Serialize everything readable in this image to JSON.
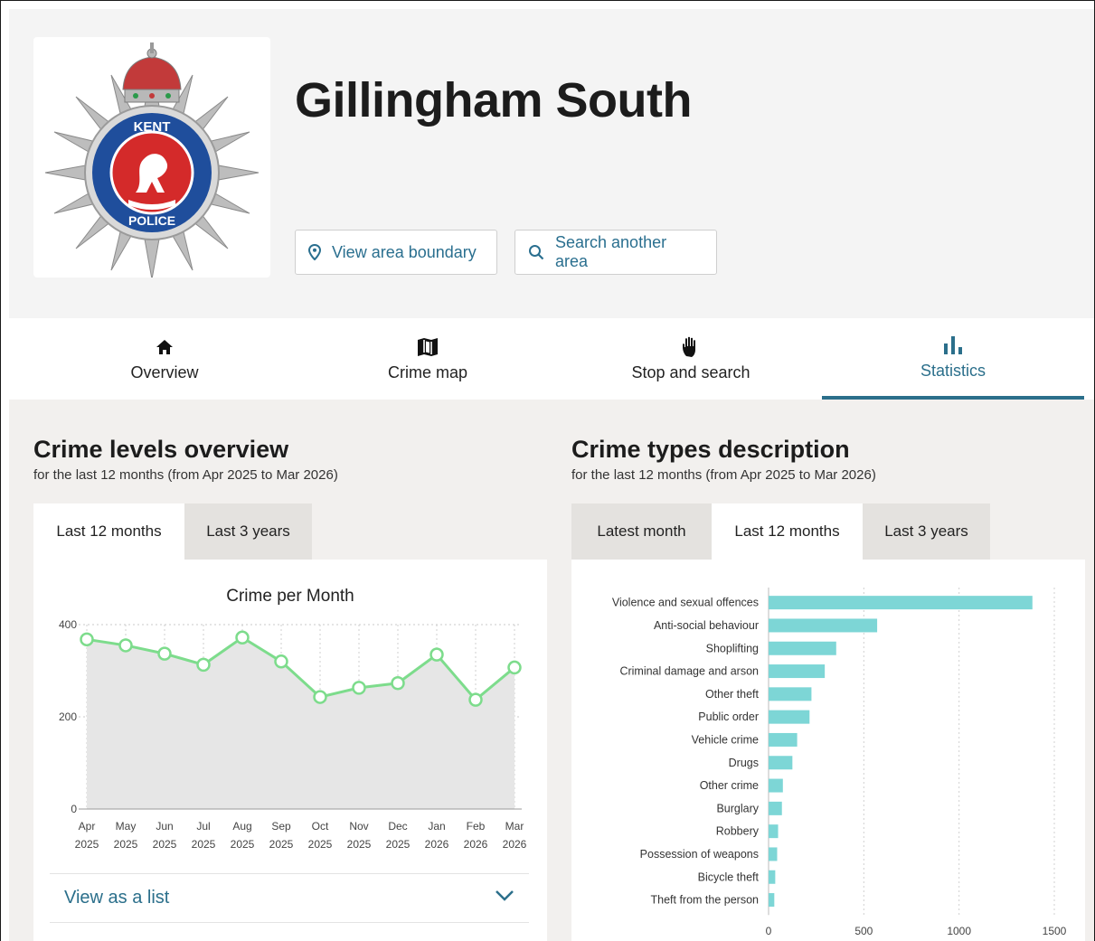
{
  "logo": {
    "top_word": "KENT",
    "bottom_word": "POLICE"
  },
  "area_title": "Gillingham South",
  "header_buttons": {
    "boundary": {
      "label": "View area boundary",
      "icon": "map-pin-icon"
    },
    "search": {
      "label": "Search another area",
      "icon": "search-icon"
    }
  },
  "nav_tabs": [
    {
      "label": "Overview",
      "icon": "home-icon",
      "active": false
    },
    {
      "label": "Crime map",
      "icon": "map-icon",
      "active": false
    },
    {
      "label": "Stop and search",
      "icon": "hand-icon",
      "active": false
    },
    {
      "label": "Statistics",
      "icon": "bar-chart-icon",
      "active": true
    }
  ],
  "left_panel": {
    "title": "Crime levels overview",
    "subtitle": "for the last 12 months (from Apr 2025 to Mar 2026)",
    "tabs": [
      {
        "label": "Last 12 months",
        "active": true
      },
      {
        "label": "Last 3 years",
        "active": false
      }
    ],
    "view_list_label": "View as a list"
  },
  "right_panel": {
    "title": "Crime types description",
    "subtitle": "for the last 12 months (from Apr 2025 to Mar 2026)",
    "tabs": [
      {
        "label": "Latest month",
        "active": false
      },
      {
        "label": "Last 12 months",
        "active": true
      },
      {
        "label": "Last 3 years",
        "active": false
      }
    ]
  },
  "colors": {
    "accent": "#2b6f8b",
    "line": "#7ddc8c",
    "area_fill": "#e6e6e6",
    "bar": "#7dd6d6"
  },
  "chart_data": [
    {
      "type": "line",
      "title": "Crime per Month",
      "categories": [
        [
          "Apr",
          "2025"
        ],
        [
          "May",
          "2025"
        ],
        [
          "Jun",
          "2025"
        ],
        [
          "Jul",
          "2025"
        ],
        [
          "Aug",
          "2025"
        ],
        [
          "Sep",
          "2025"
        ],
        [
          "Oct",
          "2025"
        ],
        [
          "Nov",
          "2025"
        ],
        [
          "Dec",
          "2025"
        ],
        [
          "Jan",
          "2026"
        ],
        [
          "Feb",
          "2026"
        ],
        [
          "Mar",
          "2026"
        ]
      ],
      "values": [
        368,
        355,
        337,
        313,
        372,
        320,
        243,
        263,
        273,
        335,
        237,
        307
      ],
      "ylim": [
        0,
        400
      ],
      "yticks": [
        0,
        200,
        400
      ],
      "grid": true
    },
    {
      "type": "bar",
      "orientation": "horizontal",
      "categories": [
        "Violence and sexual offences",
        "Anti-social behaviour",
        "Shoplifting",
        "Criminal damage and arson",
        "Other theft",
        "Public order",
        "Vehicle crime",
        "Drugs",
        "Other crime",
        "Burglary",
        "Robbery",
        "Possession of weapons",
        "Bicycle theft",
        "Theft from the person"
      ],
      "values": [
        1385,
        570,
        355,
        295,
        225,
        215,
        150,
        125,
        75,
        70,
        50,
        45,
        35,
        30
      ],
      "xlim": [
        0,
        1500
      ],
      "xticks": [
        0,
        500,
        1000,
        1500
      ],
      "grid": true
    }
  ]
}
